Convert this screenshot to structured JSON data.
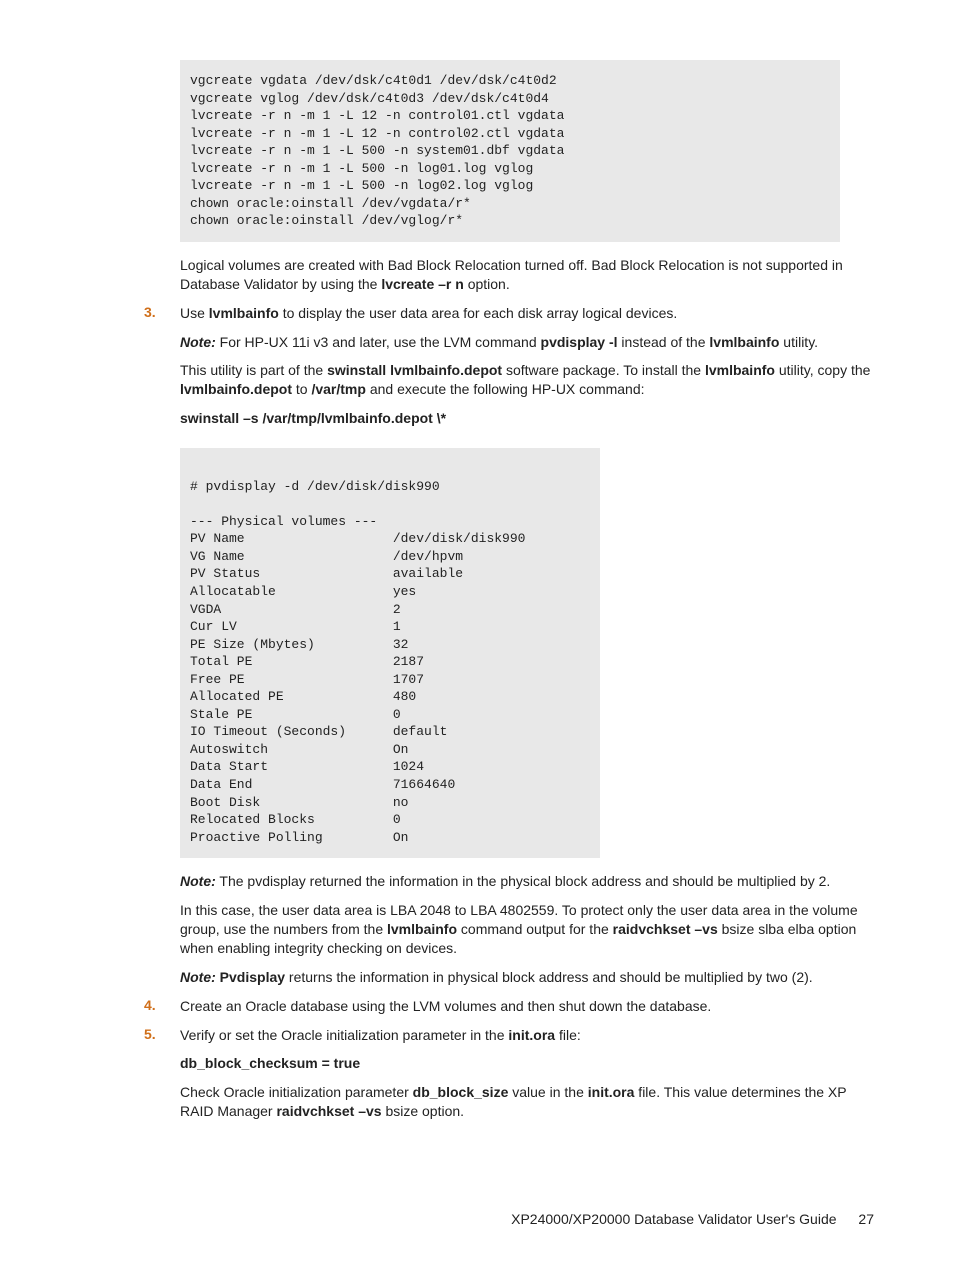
{
  "code1": "vgcreate vgdata /dev/dsk/c4t0d1 /dev/dsk/c4t0d2\nvgcreate vglog /dev/dsk/c4t0d3 /dev/dsk/c4t0d4\nlvcreate -r n -m 1 -L 12 -n control01.ctl vgdata\nlvcreate -r n -m 1 -L 12 -n control02.ctl vgdata\nlvcreate -r n -m 1 -L 500 -n system01.dbf vgdata\nlvcreate -r n -m 1 -L 500 -n log01.log vglog\nlvcreate -r n -m 1 -L 500 -n log02.log vglog\nchown oracle:oinstall /dev/vgdata/r*\nchown oracle:oinstall /dev/vglog/r*",
  "p1a": "Logical volumes are created with Bad Block Relocation turned off. Bad Block Relocation is not supported in Database Validator by using the ",
  "p1b": "lvcreate –r n",
  "p1c": " option.",
  "step3": {
    "num": "3.",
    "a": "Use ",
    "b": "lvmlbainfo",
    "c": " to display the user data area for each disk array logical devices."
  },
  "note1": {
    "label": "Note:",
    "a": "  For HP-UX 11i v3 and later, use the LVM command ",
    "b": "pvdisplay -l",
    "c": " instead of the ",
    "d": "lvmlbainfo",
    "e": " utility."
  },
  "p2": {
    "a": "This utility is part of the ",
    "b": "swinstall lvmlbainfo.depot",
    "c": " software package. To install the ",
    "d": "lvmlbainfo",
    "e": " utility, copy the ",
    "f": "lvmlbainfo.depot",
    "g": " to ",
    "h": "/var/tmp",
    "i": " and execute the following HP-UX command:"
  },
  "cmd1": "swinstall –s /var/tmp/lvmlbainfo.depot \\*",
  "code2": "\n# pvdisplay -d /dev/disk/disk990\n\n--- Physical volumes ---\nPV Name                   /dev/disk/disk990\nVG Name                   /dev/hpvm\nPV Status                 available\nAllocatable               yes\nVGDA                      2\nCur LV                    1\nPE Size (Mbytes)          32\nTotal PE                  2187\nFree PE                   1707\nAllocated PE              480\nStale PE                  0\nIO Timeout (Seconds)      default\nAutoswitch                On\nData Start                1024\nData End                  71664640\nBoot Disk                 no\nRelocated Blocks          0\nProactive Polling         On",
  "note2": {
    "label": "Note:",
    "a": "  The pvdisplay returned the information in the physical block address and should be multiplied by 2."
  },
  "p3": {
    "a": "In this case, the user data area is LBA 2048 to LBA 4802559. To protect only the user data area in the volume group, use the numbers from the ",
    "b": "lvmlbainfo",
    "c": " command output for the ",
    "d": "raidvchkset –vs",
    "e": " bsize slba elba option when enabling integrity checking on devices."
  },
  "note3": {
    "label": "Note:",
    "a": "   ",
    "b": "Pvdisplay",
    "c": "  returns the information in physical block address and should be multiplied by two (2)."
  },
  "step4": {
    "num": "4.",
    "a": "Create an Oracle database using the LVM volumes and then shut down the database."
  },
  "step5": {
    "num": "5.",
    "a": "Verify or set the Oracle initialization parameter in the ",
    "b": "init.ora",
    "c": " file:"
  },
  "cmd2": "db_block_checksum = true",
  "p4": {
    "a": "Check Oracle initialization parameter ",
    "b": "db_block_size",
    "c": " value in the ",
    "d": "init.ora",
    "e": " file. This value determines the XP RAID Manager ",
    "f": "raidvchkset –vs",
    "g": " bsize option."
  },
  "footer": {
    "title": "XP24000/XP20000 Database Validator User's Guide",
    "page": "27"
  }
}
